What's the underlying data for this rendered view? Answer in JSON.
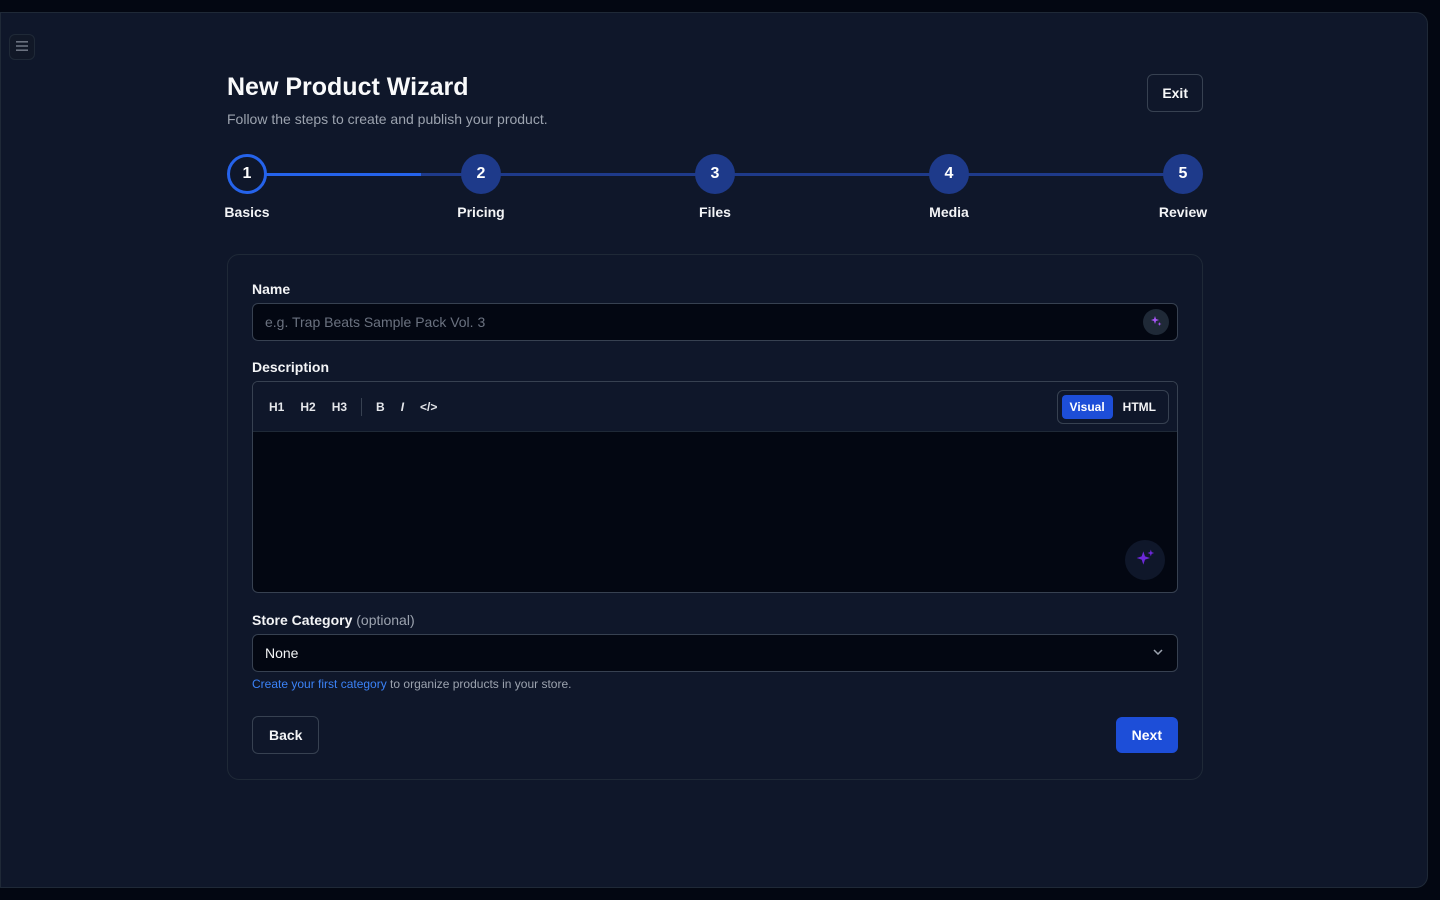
{
  "colors": {
    "accent": "#2563eb",
    "background": "#0f172a",
    "step_inactive": "#1e3a8a"
  },
  "menu": {
    "icon": "hamburger-icon"
  },
  "header": {
    "title": "New Product Wizard",
    "subtitle": "Follow the steps to create and publish your product.",
    "exit_label": "Exit"
  },
  "stepper": {
    "current_step": 1,
    "steps": [
      {
        "number": "1",
        "label": "Basics"
      },
      {
        "number": "2",
        "label": "Pricing"
      },
      {
        "number": "3",
        "label": "Files"
      },
      {
        "number": "4",
        "label": "Media"
      },
      {
        "number": "5",
        "label": "Review"
      }
    ]
  },
  "form": {
    "name": {
      "label": "Name",
      "value": "",
      "placeholder": "e.g. Trap Beats Sample Pack Vol. 3",
      "ai_icon": "sparkles-icon"
    },
    "description": {
      "label": "Description",
      "toolbar": {
        "h1": "H1",
        "h2": "H2",
        "h3": "H3",
        "bold": "B",
        "italic": "I",
        "code": "</>"
      },
      "modes": {
        "visual": "Visual",
        "html": "HTML",
        "active": "Visual"
      },
      "value": "",
      "ai_icon": "sparkles-icon"
    },
    "category": {
      "label": "Store Category",
      "optional": "(optional)",
      "selected": "None",
      "hint_link": "Create your first category",
      "hint_text": " to organize products in your store."
    }
  },
  "actions": {
    "back_label": "Back",
    "next_label": "Next"
  }
}
